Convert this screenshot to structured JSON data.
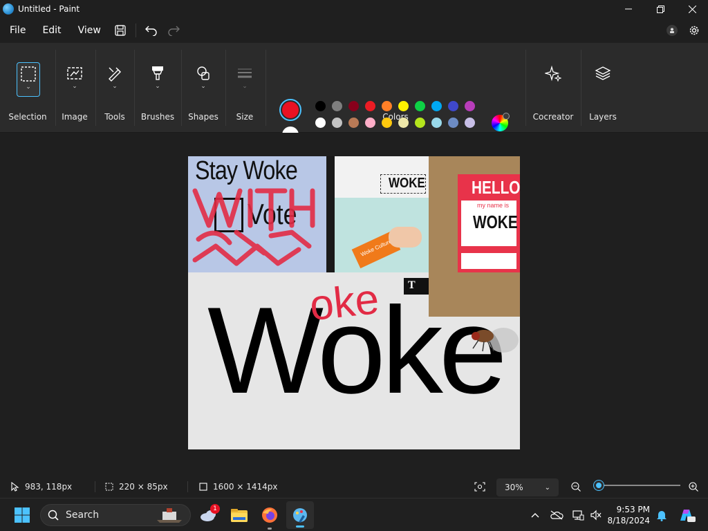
{
  "window": {
    "title": "Untitled - Paint"
  },
  "menu": {
    "file": "File",
    "edit": "Edit",
    "view": "View"
  },
  "ribbon": {
    "selection": "Selection",
    "image": "Image",
    "tools": "Tools",
    "brushes": "Brushes",
    "shapes": "Shapes",
    "size": "Size",
    "colors": "Colors",
    "cocreator": "Cocreator",
    "layers": "Layers"
  },
  "colors": {
    "primary": "#e81123",
    "secondary": "#ffffff",
    "row1": [
      "#000000",
      "#7f7f7f",
      "#88001b",
      "#ec1c24",
      "#ff7f27",
      "#fff200",
      "#0ed145",
      "#00a8f3",
      "#3f48cc",
      "#b83dba"
    ],
    "row2": [
      "#ffffff",
      "#c3c3c3",
      "#b97a56",
      "#ffaec8",
      "#ffc90e",
      "#eee8aa",
      "#b5e61d",
      "#99d9ea",
      "#6d8cc4",
      "#c8bfe7"
    ],
    "accent": "#4cc2ff"
  },
  "canvas": {
    "stay_woke": "Stay Woke",
    "vote": "Vote",
    "scrawl": "WITH COLLAB",
    "woke_tag": "WOKE",
    "hello": "HELLO",
    "my_name_is": "my name is",
    "name_woke": "WOKE",
    "key_label": "Woke Culture",
    "nyt": "T",
    "big_word": "Woke",
    "red_oke": "oke"
  },
  "status": {
    "cursor": "983, 118px",
    "selection_size": "220 × 85px",
    "canvas_size": "1600 × 1414px",
    "zoom": "30%",
    "zoom_level": 0.05
  },
  "taskbar": {
    "search": "Search",
    "weather_badge": "1",
    "time": "9:53 PM",
    "date": "8/18/2024"
  }
}
